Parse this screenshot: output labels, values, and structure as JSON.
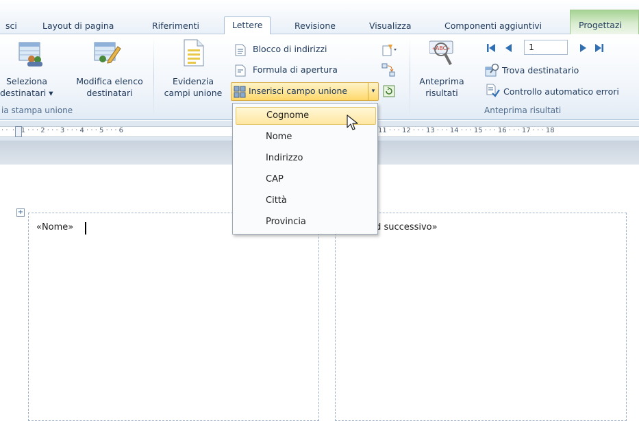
{
  "tabs": [
    {
      "label": "sci",
      "active": false
    },
    {
      "label": "Layout di pagina",
      "active": false
    },
    {
      "label": "Riferimenti",
      "active": false
    },
    {
      "label": "Lettere",
      "active": true
    },
    {
      "label": "Revisione",
      "active": false
    },
    {
      "label": "Visualizza",
      "active": false
    },
    {
      "label": "Componenti aggiuntivi",
      "active": false
    },
    {
      "label": "Progettazi",
      "active": false,
      "contextual": true
    }
  ],
  "ribbon": {
    "start_group": {
      "label": "ia stampa unione",
      "select_recipients": {
        "line1": "Seleziona",
        "line2": "destinatari",
        "dropdown": "▾"
      },
      "edit_list": {
        "line1": "Modifica elenco",
        "line2": "destinatari"
      }
    },
    "write_group": {
      "highlight": {
        "line1": "Evidenzia",
        "line2": "campi unione"
      },
      "address_block": "Blocco di indirizzi",
      "greeting_line": "Formula di apertura",
      "insert_field": "Inserisci campo unione",
      "insert_field_arrow": "▾"
    },
    "preview_group": {
      "label": "Anteprima risultati",
      "preview": {
        "line1": "Anteprima",
        "line2": "risultati"
      },
      "record_number": "1",
      "find_recipient": "Trova destinatario",
      "auto_check": "Controllo automatico errori"
    }
  },
  "ruler": {
    "marks": "· ·  · · 1 · · · 2 · · · 3 · · · 4 · · · 5 · · · 6",
    "marks_right": "11 · · · 12 · · · 13 · · · 14 · · · 15 · · · 16 · · · 17 · · · 18"
  },
  "document": {
    "cell1_text": "«Nome»",
    "cell2_text": "rd successivo»"
  },
  "insert_field_menu": {
    "items": [
      "Cognome",
      "Nome",
      "Indirizzo",
      "CAP",
      "Città",
      "Provincia"
    ],
    "highlighted": "Cognome"
  }
}
